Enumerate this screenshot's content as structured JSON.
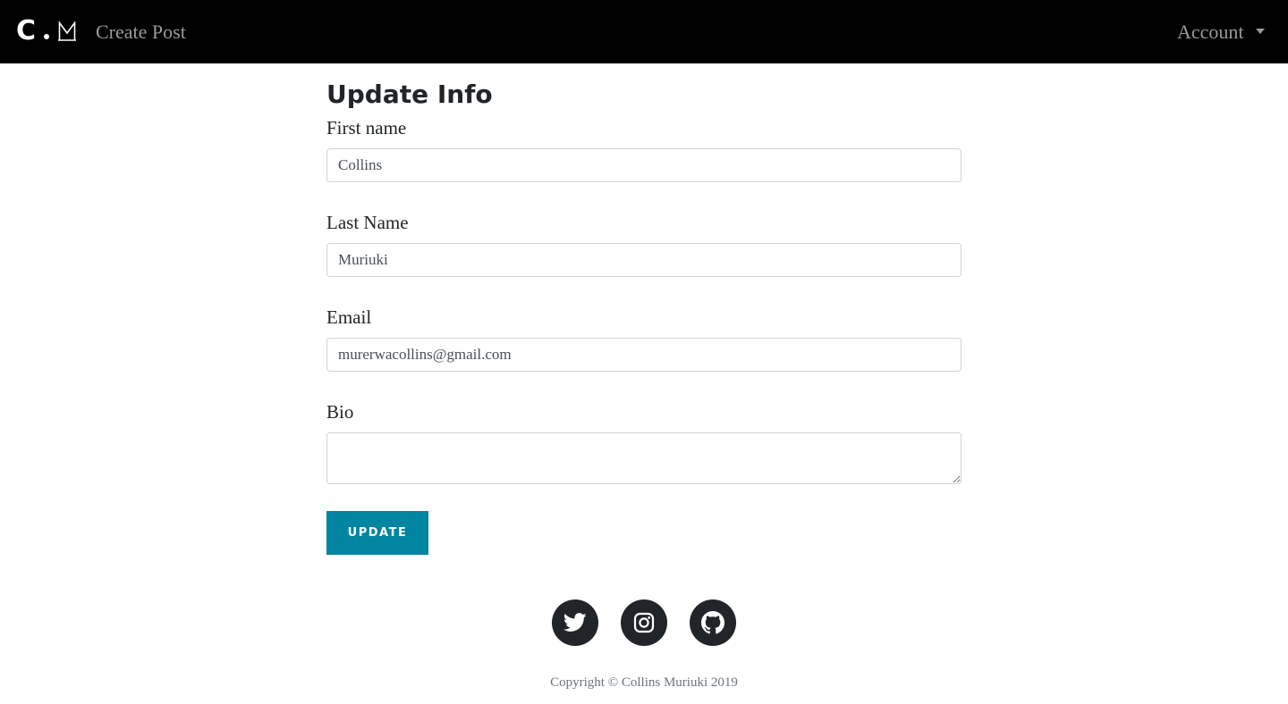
{
  "navbar": {
    "brand_letter": "C",
    "brand_logo_name": "cm-logo",
    "create_post_label": "Create Post",
    "account_label": "Account",
    "background": "#000000"
  },
  "form": {
    "title": "Update Info",
    "first_name": {
      "label": "First name",
      "value": "Collins"
    },
    "last_name": {
      "label": "Last Name",
      "value": "Muriuki"
    },
    "email": {
      "label": "Email",
      "value": "murerwacollins@gmail.com"
    },
    "bio": {
      "label": "Bio",
      "value": ""
    },
    "submit_label": "UPDATE",
    "submit_color": "#0285a0"
  },
  "footer": {
    "social_icons": [
      "twitter-icon",
      "instagram-icon",
      "github-icon"
    ],
    "copyright": "Copyright © Collins Muriuki 2019"
  }
}
